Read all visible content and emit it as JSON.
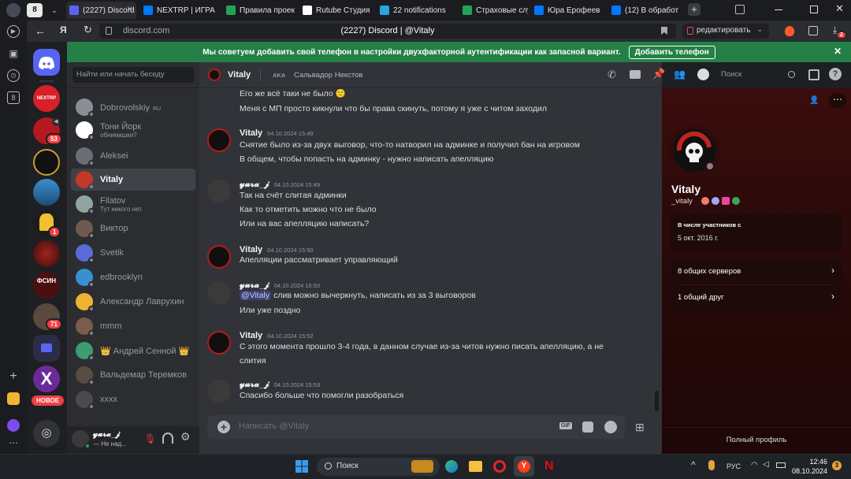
{
  "browser": {
    "tab_count": "8",
    "tabs": [
      {
        "label": "(2227) Discord",
        "color": "#5865f2",
        "icon": "discord-icon"
      },
      {
        "label": "NEXTRP | ИГРА",
        "color": "#0077ff",
        "icon": "vk-icon"
      },
      {
        "label": "Правила проек",
        "color": "#23a455",
        "icon": "sheets-icon"
      },
      {
        "label": "Rutube Студия",
        "color": "#ffffff",
        "icon": "rutube-icon"
      },
      {
        "label": "22 notifications",
        "color": "#2aa3e0",
        "icon": "telegram-icon"
      },
      {
        "label": "Страховые слу",
        "color": "#23a455",
        "icon": "sheets-icon"
      },
      {
        "label": "Юра Ерофеев",
        "color": "#0077ff",
        "icon": "vk-icon"
      },
      {
        "label": "(12) В обработ",
        "color": "#0077ff",
        "icon": "vk-icon"
      }
    ],
    "url": "discord.com",
    "page_title": "(2227) Discord | @Vitaly",
    "edit_button": "редактировать",
    "download_badge": "2"
  },
  "banner": {
    "text": "Мы советуем добавить свой телефон в настройки двухфакторной аутентификации как запасной вариант.",
    "button": "Добавить телефон"
  },
  "guilds": {
    "badges": [
      "53",
      "1",
      "71"
    ],
    "new_label": "НОВОЕ",
    "nextrp": "NEXTRP",
    "fsin": "ФСИН"
  },
  "sidebar": {
    "search_placeholder": "Найти или начать беседу",
    "dms": [
      {
        "name": "Dobrovolskiy",
        "tag": "RU",
        "sub": "",
        "color": "#8a8f96"
      },
      {
        "name": "Тони Йорк",
        "tag": "",
        "sub": "обнимашки?",
        "color": "#ffffff"
      },
      {
        "name": "Aleksei",
        "tag": "",
        "sub": "",
        "color": "#6b6f75"
      },
      {
        "name": "Vitaly",
        "tag": "",
        "sub": "",
        "color": "#c0392b"
      },
      {
        "name": "Filatov",
        "tag": "",
        "sub": "Тут никого нет.",
        "color": "#8fa5a0"
      },
      {
        "name": "Виктор",
        "tag": "",
        "sub": "",
        "color": "#6e5a4e"
      },
      {
        "name": "Svetik",
        "tag": "",
        "sub": "",
        "color": "#5a6bd8"
      },
      {
        "name": "edbrooklyn",
        "tag": "",
        "sub": "",
        "color": "#3a8fd1"
      },
      {
        "name": "Александр Лаврухин",
        "tag": "",
        "sub": "",
        "color": "#f0b232"
      },
      {
        "name": "mmm",
        "tag": "",
        "sub": "",
        "color": "#7b5c4c"
      },
      {
        "name": "👑 Андрей Сенной 👑",
        "tag": "",
        "sub": "",
        "color": "#3a9e6f"
      },
      {
        "name": "Вальдемар Теремков",
        "tag": "",
        "sub": "",
        "color": "#5a4b43"
      },
      {
        "name": "xxxx",
        "tag": "",
        "sub": "",
        "color": "#4a4a4a"
      }
    ]
  },
  "userbar": {
    "name": "𝔂𝓾𝓻𝓪_𝓳",
    "status": "— Не над..."
  },
  "chat_header": {
    "name": "Vitaly",
    "aka_label": "AKA",
    "aka": "Сальвадор Некстов",
    "search_placeholder": "Поиск"
  },
  "messages": [
    {
      "author": "",
      "time": "",
      "lines": [
        "Его же всё таки не было 🙁",
        "Меня с МП просто кикнули что бы права скинуть, потому я уже с читом заходил"
      ],
      "avatar": ""
    },
    {
      "author": "Vitaly",
      "time": "04.10.2024 15:49",
      "lines": [
        "Снятие было из-за двух выговор, что-то натворил на админке и получил бан на игровом",
        "В общем, чтобы попасть на админку - нужно написать апелляцию"
      ],
      "avatar": "vitaly"
    },
    {
      "author": "𝔂𝓾𝓻𝓪_𝓳",
      "time": "04.10.2024 15:49",
      "lines": [
        "Так на счёт слитая админки",
        "Как то отметить можно что не было",
        "Или на вас апелляцию написать?"
      ],
      "avatar": "yura"
    },
    {
      "author": "Vitaly",
      "time": "04.10.2024 15:50",
      "lines": [
        "Апелляции рассматривает управляющий"
      ],
      "avatar": "vitaly"
    },
    {
      "author": "𝔂𝓾𝓻𝓪_𝓳",
      "time": "04.10.2024 15:50",
      "mention": "@Vitaly",
      "lines": [
        " слив можно вычеркнуть, написать из за 3 выговоров",
        "Или уже поздно"
      ],
      "avatar": "yura"
    },
    {
      "author": "Vitaly",
      "time": "04.10.2024 15:52",
      "lines": [
        "С этого момента прошло 3-4 года, в данном случае из-за читов нужно писать апелляцию, а не",
        "слития"
      ],
      "avatar": "vitaly"
    },
    {
      "author": "𝔂𝓾𝓻𝓪_𝓳",
      "time": "04.10.2024 15:53",
      "lines": [
        "Спасибо больше что помогли разобраться"
      ],
      "avatar": "yura"
    }
  ],
  "composer": {
    "placeholder": "Написать @Vitaly",
    "gif": "GIF"
  },
  "profile": {
    "display_name": "Vitaly",
    "username": "_vitaly",
    "member_since_label": "В числе участников с",
    "member_since": "5 окт. 2016 г.",
    "mutual_servers": "8 общих серверов",
    "mutual_friends": "1 общий друг",
    "full_profile": "Полный профиль"
  },
  "taskbar": {
    "search": "Поиск",
    "lang": "РУС",
    "time": "12:46",
    "date": "08.10.2024",
    "notif": "3"
  }
}
